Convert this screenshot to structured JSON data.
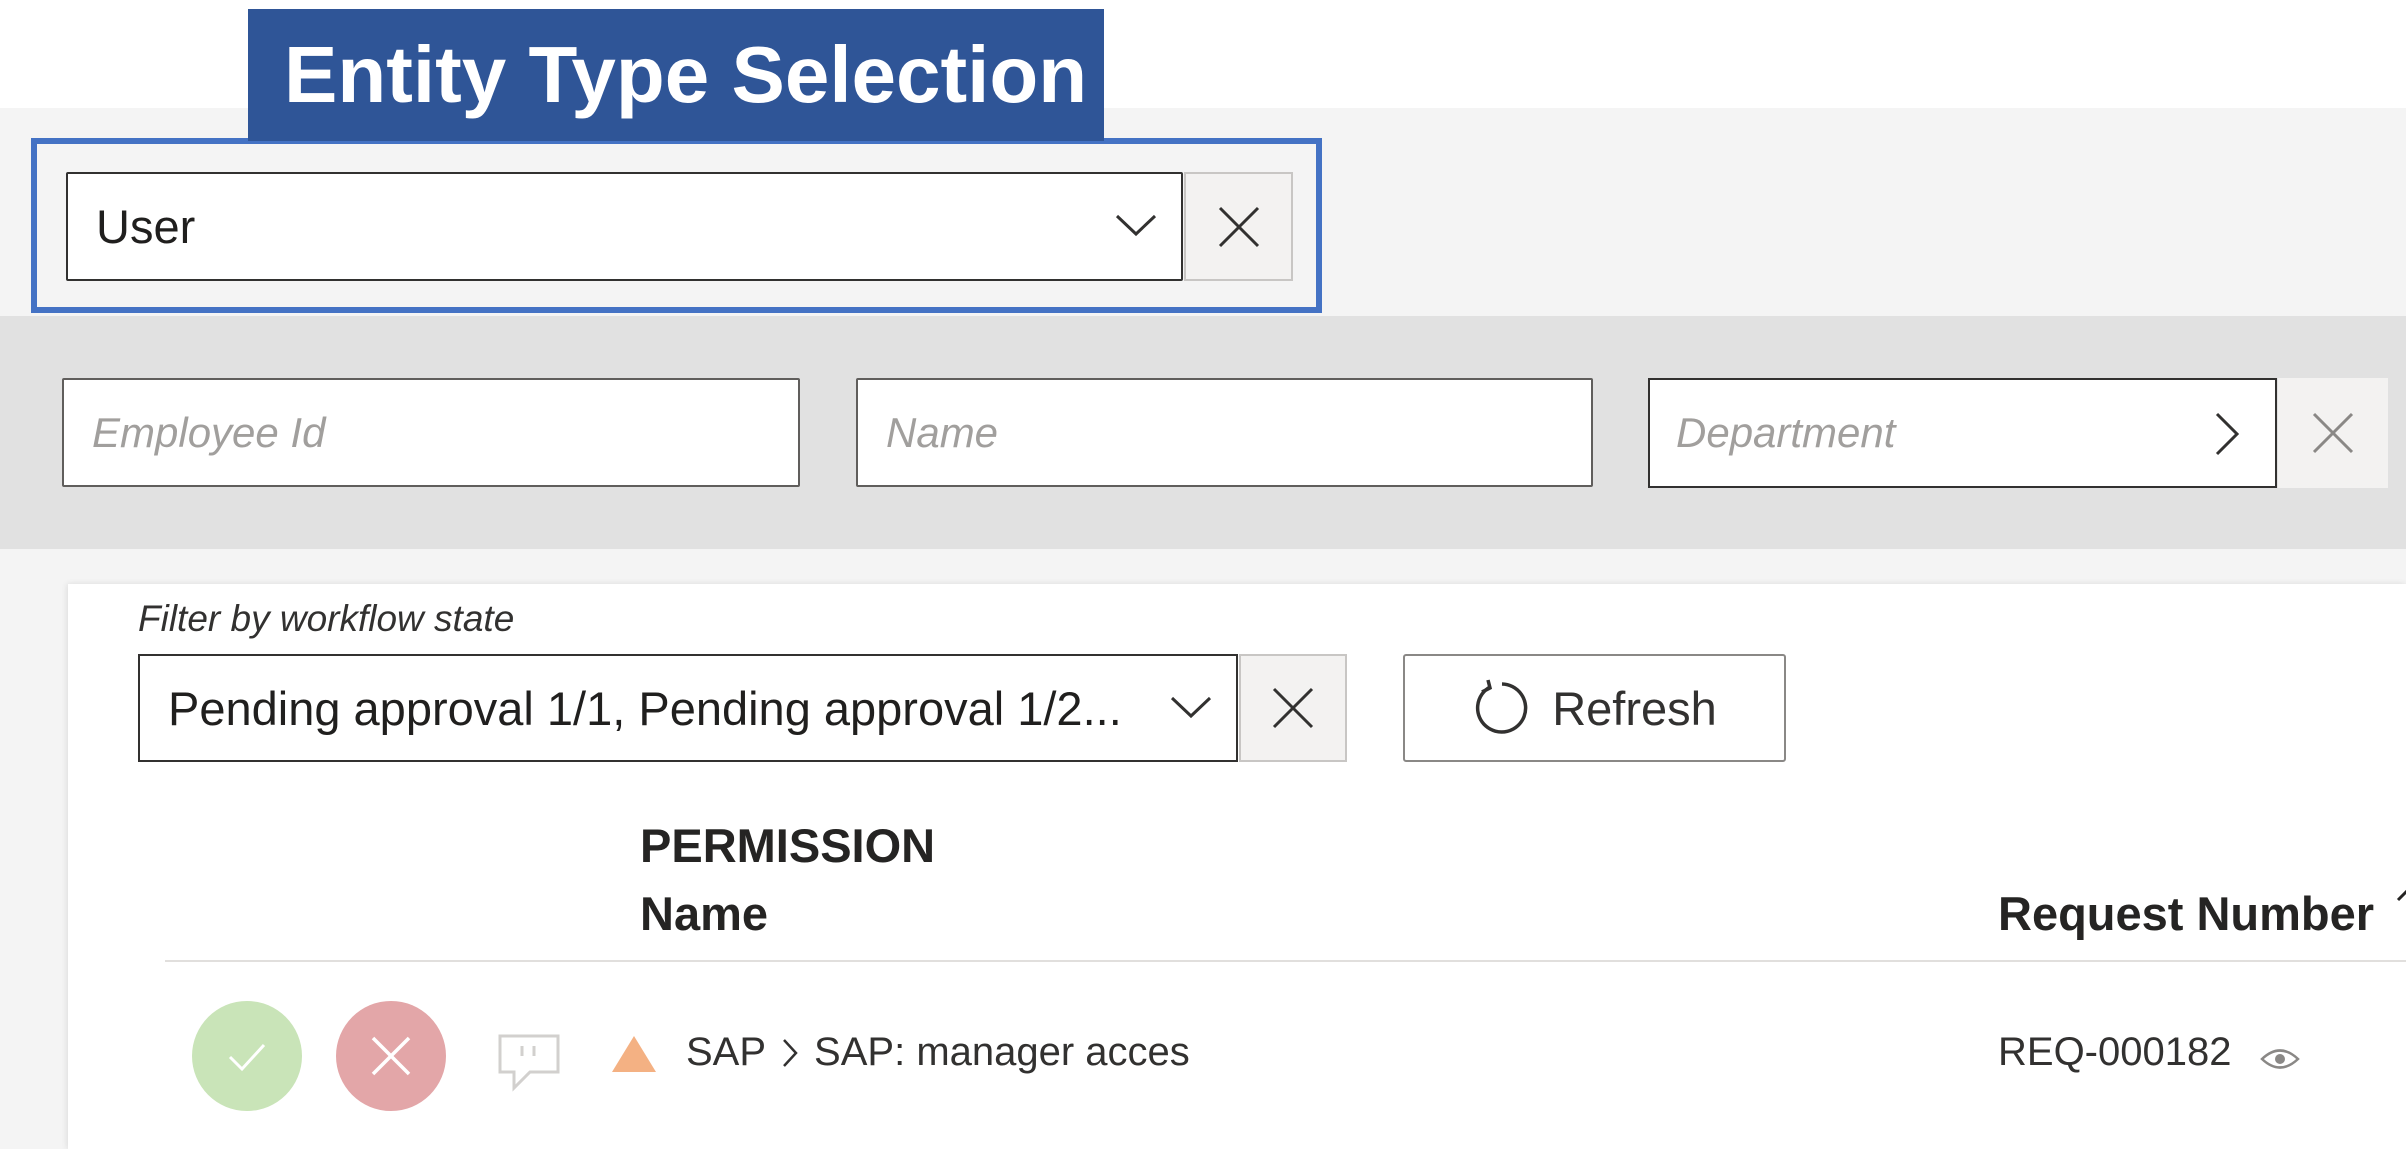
{
  "callout": {
    "title": "Entity Type Selection"
  },
  "entity_type": {
    "value": "User"
  },
  "filters": {
    "employee_id_placeholder": "Employee Id",
    "name_placeholder": "Name",
    "department_placeholder": "Department"
  },
  "workflow": {
    "label": "Filter by workflow state",
    "value": "Pending approval 1/1, Pending approval 1/2..."
  },
  "refresh": {
    "label": "Refresh"
  },
  "table": {
    "permission_header": "PERMISSION",
    "name_header": "Name",
    "request_number_header": "Request Number",
    "rows": [
      {
        "system": "SAP",
        "permission": "SAP: manager acces",
        "request_number": "REQ-000182"
      }
    ]
  },
  "colors": {
    "callout": "#2f5597",
    "callout_border": "#4472c4",
    "approve": "#c9e4b8",
    "reject": "#e3a6a8",
    "warning": "#f4b183"
  }
}
